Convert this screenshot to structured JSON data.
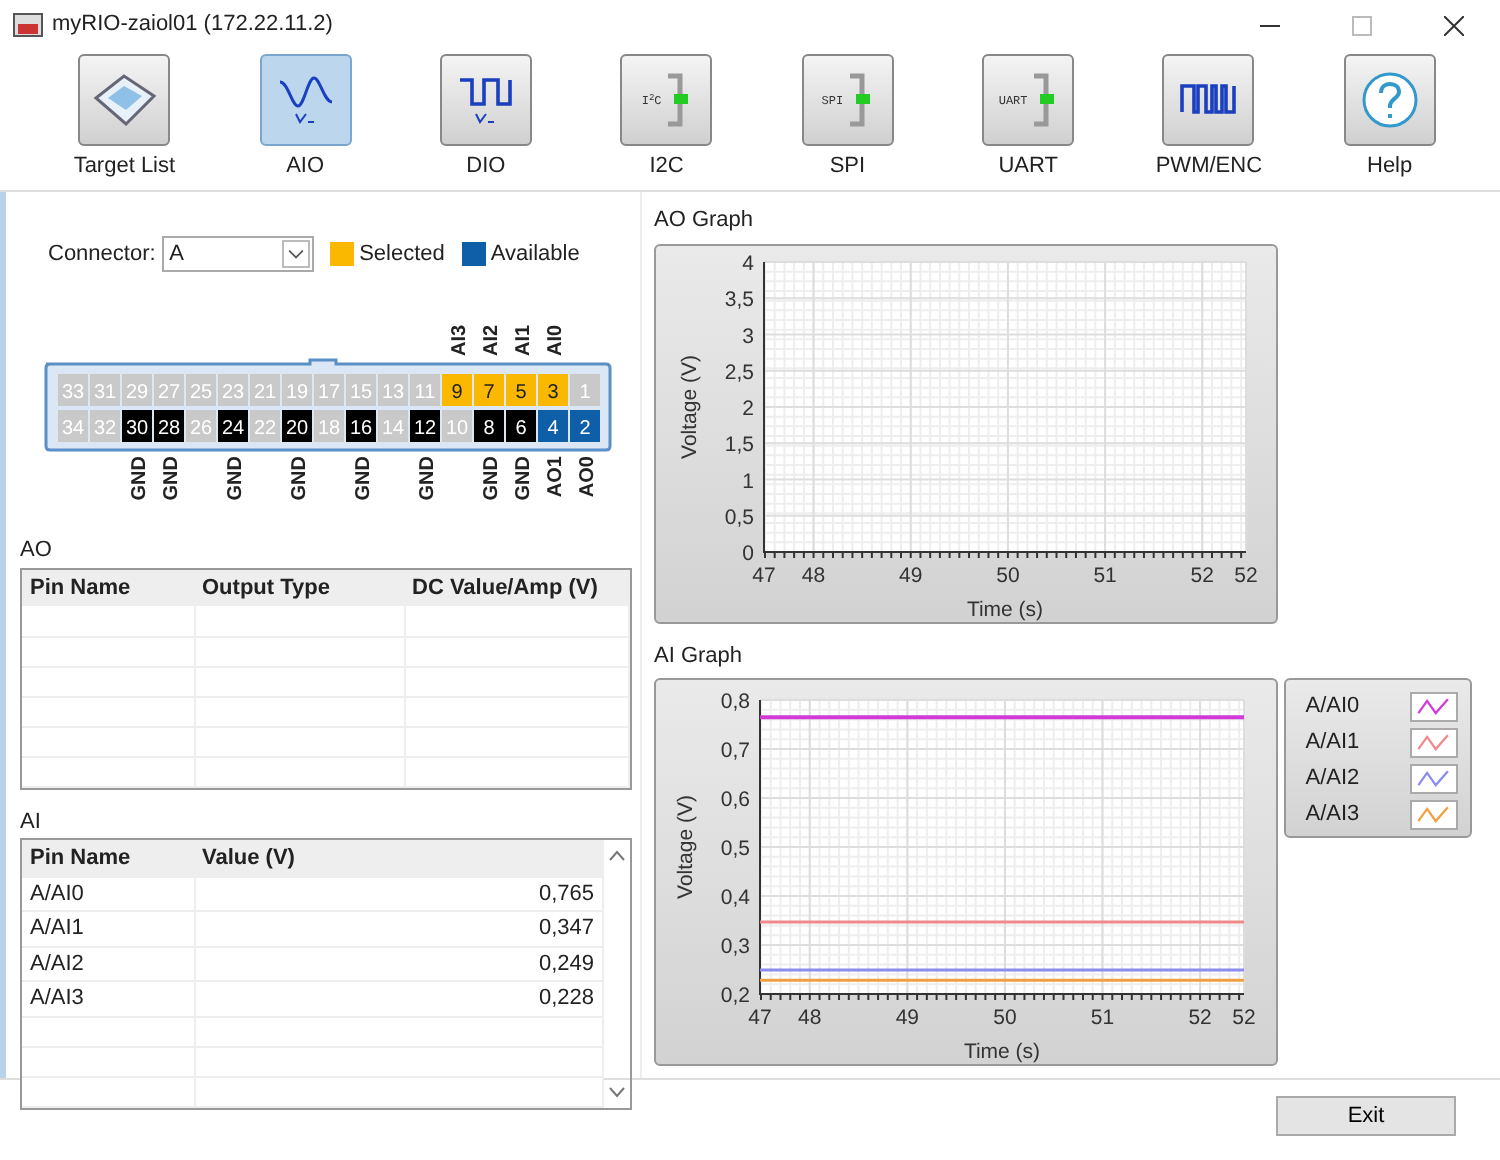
{
  "window": {
    "title": "myRIO-zaiol01 (172.22.11.2)"
  },
  "toolbar": [
    {
      "label": "Target List",
      "kind": "tablet",
      "selected": false
    },
    {
      "label": "AIO",
      "kind": "analog",
      "selected": true
    },
    {
      "label": "DIO",
      "kind": "digital",
      "selected": false
    },
    {
      "label": "I2C",
      "kind": "bus",
      "icon_text": "I$^{2}$C",
      "selected": false
    },
    {
      "label": "SPI",
      "kind": "bus",
      "icon_text": "SPI",
      "selected": false
    },
    {
      "label": "UART",
      "kind": "bus",
      "icon_text": "UART",
      "selected": false
    },
    {
      "label": "PWM/ENC",
      "kind": "pwm",
      "selected": false
    },
    {
      "label": "Help",
      "kind": "help",
      "selected": false
    }
  ],
  "connector": {
    "label": "Connector:",
    "value": "A",
    "legend": [
      {
        "label": "Selected",
        "color": "#fbb800"
      },
      {
        "label": "Available",
        "color": "#0f5ea8"
      }
    ],
    "top_row": [
      {
        "number": "33",
        "kind": "unused"
      },
      {
        "number": "31",
        "kind": "unused"
      },
      {
        "number": "29",
        "kind": "unused"
      },
      {
        "number": "27",
        "kind": "unused"
      },
      {
        "number": "25",
        "kind": "unused"
      },
      {
        "number": "23",
        "kind": "unused"
      },
      {
        "number": "21",
        "kind": "unused"
      },
      {
        "number": "19",
        "kind": "unused"
      },
      {
        "number": "17",
        "kind": "unused"
      },
      {
        "number": "15",
        "kind": "unused"
      },
      {
        "number": "13",
        "kind": "unused"
      },
      {
        "number": "11",
        "kind": "unused"
      },
      {
        "number": "9",
        "kind": "selected",
        "label": "AI3"
      },
      {
        "number": "7",
        "kind": "selected",
        "label": "AI2"
      },
      {
        "number": "5",
        "kind": "selected",
        "label": "AI1"
      },
      {
        "number": "3",
        "kind": "selected",
        "label": "AI0"
      },
      {
        "number": "1",
        "kind": "unused"
      }
    ],
    "bottom_row": [
      {
        "number": "34",
        "kind": "unused"
      },
      {
        "number": "32",
        "kind": "unused"
      },
      {
        "number": "30",
        "kind": "ground",
        "label": "GND"
      },
      {
        "number": "28",
        "kind": "ground",
        "label": "GND"
      },
      {
        "number": "26",
        "kind": "unused"
      },
      {
        "number": "24",
        "kind": "ground",
        "label": "GND"
      },
      {
        "number": "22",
        "kind": "unused"
      },
      {
        "number": "20",
        "kind": "ground",
        "label": "GND"
      },
      {
        "number": "18",
        "kind": "unused"
      },
      {
        "number": "16",
        "kind": "ground",
        "label": "GND"
      },
      {
        "number": "14",
        "kind": "unused"
      },
      {
        "number": "12",
        "kind": "ground",
        "label": "GND"
      },
      {
        "number": "10",
        "kind": "unused"
      },
      {
        "number": "8",
        "kind": "ground",
        "label": "GND"
      },
      {
        "number": "6",
        "kind": "ground",
        "label": "GND"
      },
      {
        "number": "4",
        "kind": "available",
        "label": "AO1"
      },
      {
        "number": "2",
        "kind": "available",
        "label": "AO0"
      }
    ]
  },
  "ao_table": {
    "title": "AO",
    "columns": [
      "Pin Name",
      "Output Type",
      "DC Value/Amp (V)"
    ]
  },
  "ai_table": {
    "title": "AI",
    "columns": [
      "Pin Name",
      "Value (V)"
    ],
    "rows": [
      [
        "A/AI0",
        "0,765"
      ],
      [
        "A/AI1",
        "0,347"
      ],
      [
        "A/AI2",
        "0,249"
      ],
      [
        "A/AI3",
        "0,228"
      ]
    ]
  },
  "ao_graph": {
    "title": "AO Graph",
    "chart_data": {
      "type": "line",
      "grid": true,
      "xlabel": "Time (s)",
      "ylabel": "Voltage (V)",
      "xlim": [
        47.49,
        52.45
      ],
      "ylim": [
        0,
        4
      ],
      "xticks": [
        {
          "value": 47.49,
          "label": "47"
        },
        {
          "value": 48,
          "label": "48"
        },
        {
          "value": 49,
          "label": "49"
        },
        {
          "value": 50,
          "label": "50"
        },
        {
          "value": 51,
          "label": "51"
        },
        {
          "value": 52,
          "label": "52"
        },
        {
          "value": 52.45,
          "label": "52"
        }
      ],
      "yticks": [
        {
          "value": 0,
          "label": "0"
        },
        {
          "value": 0.5,
          "label": "0,5"
        },
        {
          "value": 1,
          "label": "1"
        },
        {
          "value": 1.5,
          "label": "1,5"
        },
        {
          "value": 2,
          "label": "2"
        },
        {
          "value": 2.5,
          "label": "2,5"
        },
        {
          "value": 3,
          "label": "3"
        },
        {
          "value": 3.5,
          "label": "3,5"
        },
        {
          "value": 4,
          "label": "4"
        }
      ]
    }
  },
  "ai_graph": {
    "title": "AI Graph",
    "chart_data": {
      "type": "line",
      "grid": true,
      "xlabel": "Time (s)",
      "ylabel": "Voltage (V)",
      "xlim": [
        47.49,
        52.45
      ],
      "ylim": [
        0.2,
        0.8
      ],
      "xticks": [
        {
          "value": 47.49,
          "label": "47"
        },
        {
          "value": 48,
          "label": "48"
        },
        {
          "value": 49,
          "label": "49"
        },
        {
          "value": 50,
          "label": "50"
        },
        {
          "value": 51,
          "label": "51"
        },
        {
          "value": 52,
          "label": "52"
        },
        {
          "value": 52.45,
          "label": "52"
        }
      ],
      "yticks": [
        {
          "value": 0.2,
          "label": "0,2"
        },
        {
          "value": 0.3,
          "label": "0,3"
        },
        {
          "value": 0.4,
          "label": "0,4"
        },
        {
          "value": 0.5,
          "label": "0,5"
        },
        {
          "value": 0.6,
          "label": "0,6"
        },
        {
          "value": 0.7,
          "label": "0,7"
        },
        {
          "value": 0.8,
          "label": "0,8"
        }
      ],
      "x": [
        47.49,
        52.45
      ],
      "series": [
        {
          "name": "A/AI0",
          "color": "#d23ad8",
          "values": [
            0.765,
            0.765
          ]
        },
        {
          "name": "A/AI1",
          "color": "#f08a8a",
          "values": [
            0.347,
            0.347
          ]
        },
        {
          "name": "A/AI2",
          "color": "#8c8cf0",
          "values": [
            0.249,
            0.249
          ]
        },
        {
          "name": "A/AI3",
          "color": "#f0a040",
          "values": [
            0.228,
            0.228
          ]
        }
      ]
    }
  },
  "exit_button": "Exit"
}
